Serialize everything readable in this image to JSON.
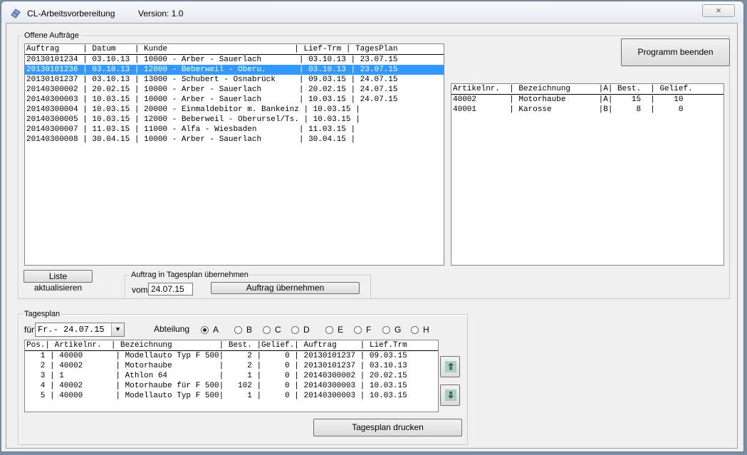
{
  "window": {
    "title": "CL-Arbeitsvorbereitung",
    "version": "Version: 1.0",
    "close_icon": "×"
  },
  "offene_auftraege": {
    "legend": "Offene Aufträge",
    "header": "Auftrag     | Datum    | Kunde                           | Lief-Trm | TagesPlan",
    "selected_index": 1,
    "rows": [
      "20130101234 | 03.10.13 | 10000 - Arber - Sauerlach        | 03.10.13 | 23.07.15",
      "20130101236 | 03.10.13 | 12000 - Beberweil - Oberu.       | 03.10.13 | 23.07.15",
      "20130101237 | 03.10.13 | 13000 - Schubert - Osnabrück     | 09.03.15 | 24.07.15",
      "20140300002 | 20.02.15 | 10000 - Arber - Sauerlach        | 20.02.15 | 24.07.15",
      "20140300003 | 10.03.15 | 10000 - Arber - Sauerlach        | 10.03.15 | 24.07.15",
      "20140300004 | 10.03.15 | 20000 - Einmaldebitor m. Bankeinz | 10.03.15 |",
      "20140300005 | 10.03.15 | 12000 - Beberweil - Oberursel/Ts. | 10.03.15 |",
      "20140300007 | 11.03.15 | 11000 - Alfa - Wiesbaden         | 11.03.15 |",
      "20140300008 | 30.04.15 | 10000 - Arber - Sauerlach        | 30.04.15 |"
    ],
    "refresh_button": "Liste aktualisieren",
    "uebernehmen_group": {
      "legend": "Auftrag in Tagesplan übernehmen",
      "vom_label": "vom",
      "vom_value": "24.07.15",
      "button": "Auftrag übernehmen"
    }
  },
  "programm_beenden": "Programm beenden",
  "artikel_list": {
    "header": "Artikelnr.  | Bezeichnung      |A| Best.  | Gelief.",
    "rows": [
      "40002       | Motorhaube       |A|    15  |    10",
      "40001       | Karosse          |B|     8  |     0"
    ]
  },
  "tagesplan": {
    "legend": "Tagesplan",
    "fuer_label": "für",
    "fuer_value": "Fr.- 24.07.15",
    "abteilung_label": "Abteilung",
    "departments": [
      "A",
      "B",
      "C",
      "D",
      "E",
      "F",
      "G",
      "H"
    ],
    "selected_department": "A",
    "header": "Pos.| Artikelnr.  | Bezeichnung          | Best. |Gelief.| Auftrag     | Lief.Trm",
    "rows": [
      "   1 | 40000       | Modellauto Typ F 500|     2 |     0 | 20130101237 | 09.03.15",
      "   2 | 40002       | Motorhaube          |     2 |     0 | 20130101237 | 03.10.13",
      "   3 | 1           | Athlon 64           |     1 |     0 | 20140300002 | 20.02.15",
      "   4 | 40002       | Motorhaube für F 500|   102 |     0 | 20140300003 | 10.03.15",
      "   5 | 40000       | Modellauto Typ F 500|     1 |     0 | 20140300003 | 10.03.15"
    ],
    "print_button": "Tagesplan drucken",
    "up_icon": "⇧",
    "down_icon": "⇩"
  }
}
